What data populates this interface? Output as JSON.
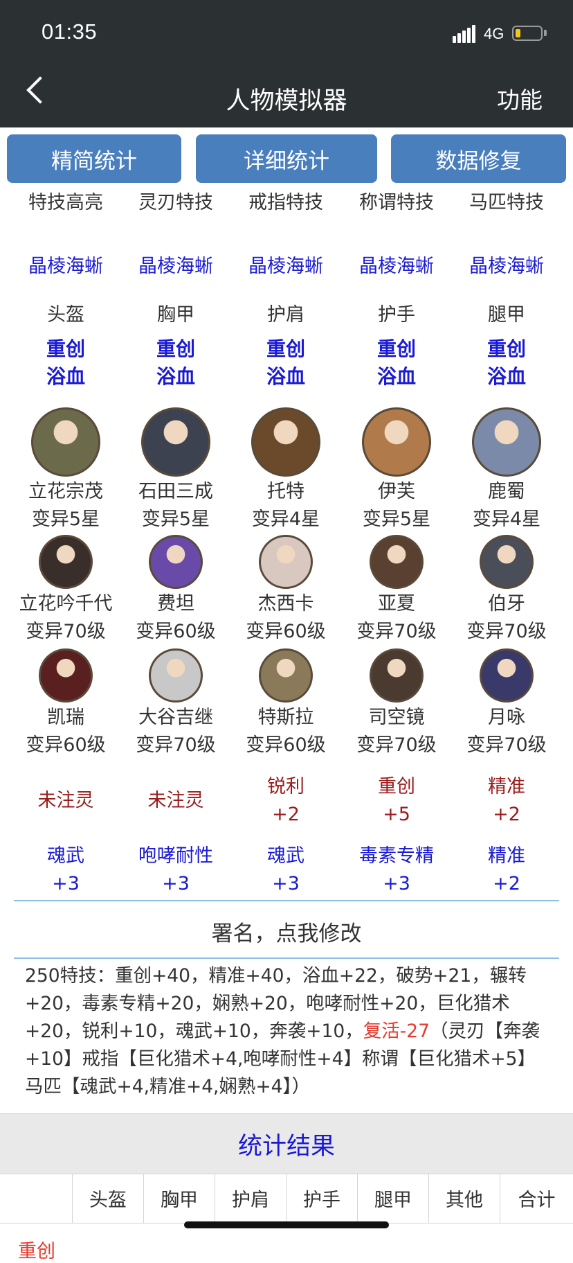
{
  "status": {
    "time": "01:35",
    "network": "4G"
  },
  "nav": {
    "title": "人物模拟器",
    "function": "功能"
  },
  "buttons": [
    "精简统计",
    "详细统计",
    "数据修复"
  ],
  "stunt_headers": [
    "特技高亮",
    "灵刃特技",
    "戒指特技",
    "称谓特技",
    "马匹特技"
  ],
  "stunt_values": [
    "晶棱海蜥",
    "晶棱海蜥",
    "晶棱海蜥",
    "晶棱海蜥",
    "晶棱海蜥"
  ],
  "armor_slots": [
    {
      "slot": "头盔",
      "a": "重创",
      "b": "浴血"
    },
    {
      "slot": "胸甲",
      "a": "重创",
      "b": "浴血"
    },
    {
      "slot": "护肩",
      "a": "重创",
      "b": "浴血"
    },
    {
      "slot": "护手",
      "a": "重创",
      "b": "浴血"
    },
    {
      "slot": "腿甲",
      "a": "重创",
      "b": "浴血"
    }
  ],
  "heroes_main": [
    {
      "name": "立花宗茂",
      "level": "变异5星",
      "color": "#6b6a4a"
    },
    {
      "name": "石田三成",
      "level": "变异5星",
      "color": "#3d4250"
    },
    {
      "name": "托特",
      "level": "变异4星",
      "color": "#6a4a2a"
    },
    {
      "name": "伊芙",
      "level": "变异5星",
      "color": "#b07a4a"
    },
    {
      "name": "鹿蜀",
      "level": "变异4星",
      "color": "#7a8aa8"
    }
  ],
  "heroes_row2": [
    {
      "name": "立花吟千代",
      "level": "变异70级",
      "color": "#3a2e2a"
    },
    {
      "name": "费坦",
      "level": "变异60级",
      "color": "#6a4aa8"
    },
    {
      "name": "杰西卡",
      "level": "变异60级",
      "color": "#d8c8c0"
    },
    {
      "name": "亚夏",
      "level": "变异70级",
      "color": "#5a4030"
    },
    {
      "name": "伯牙",
      "level": "变异70级",
      "color": "#4a4e58"
    }
  ],
  "heroes_row3": [
    {
      "name": "凯瑞",
      "level": "变异60级",
      "color": "#5a2020"
    },
    {
      "name": "大谷吉继",
      "level": "变异70级",
      "color": "#c8c8c8"
    },
    {
      "name": "特斯拉",
      "level": "变异60级",
      "color": "#8a7a5a"
    },
    {
      "name": "司空镜",
      "level": "变异70级",
      "color": "#4a3a30"
    },
    {
      "name": "月咏",
      "level": "变异70级",
      "color": "#3a3a6a"
    }
  ],
  "infusions": [
    {
      "a": "未注灵",
      "b": ""
    },
    {
      "a": "未注灵",
      "b": ""
    },
    {
      "a": "锐利",
      "b": "+2"
    },
    {
      "a": "重创",
      "b": "+5"
    },
    {
      "a": "精准",
      "b": "+2"
    }
  ],
  "soul": [
    {
      "a": "魂武",
      "b": "+3"
    },
    {
      "a": "咆哮耐性",
      "b": "+3"
    },
    {
      "a": "魂武",
      "b": "+3"
    },
    {
      "a": "毒素专精",
      "b": "+3"
    },
    {
      "a": "精准",
      "b": "+2"
    }
  ],
  "signature": "署名，点我修改",
  "summary": {
    "part1": "250特技：重创+40，精准+40，浴血+22，破势+21，辗转+20，毒素专精+20，娴熟+20，咆哮耐性+20，巨化猎术+20，锐利+10，魂武+10，奔袭+10，",
    "red": "复活-27",
    "part2": "（灵刃【奔袭+10】戒指【巨化猎术+4,咆哮耐性+4】称谓【巨化猎术+5】马匹【魂武+4,精准+4,娴熟+4】）"
  },
  "result_title": "统计结果",
  "table_headers": [
    "",
    "头盔",
    "胸甲",
    "护肩",
    "护手",
    "腿甲",
    "其他",
    "合计"
  ],
  "table_row_label": "重创"
}
